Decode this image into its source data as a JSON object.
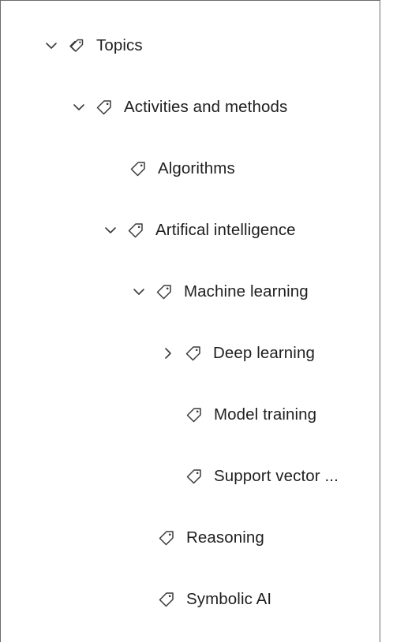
{
  "tree": {
    "items": [
      {
        "label": "Topics",
        "expander": "expanded",
        "icon": "tags-icon"
      },
      {
        "label": "Activities and methods",
        "expander": "expanded",
        "icon": "tag-icon"
      },
      {
        "label": "Algorithms",
        "expander": "none",
        "icon": "tag-icon"
      },
      {
        "label": "Artifical intelligence",
        "expander": "expanded",
        "icon": "tag-icon"
      },
      {
        "label": "Machine learning",
        "expander": "expanded",
        "icon": "tag-icon"
      },
      {
        "label": "Deep learning",
        "expander": "collapsed",
        "icon": "tag-icon"
      },
      {
        "label": "Model training",
        "expander": "none",
        "icon": "tag-icon"
      },
      {
        "label": "Support vector ...",
        "expander": "none",
        "icon": "tag-icon"
      },
      {
        "label": "Reasoning",
        "expander": "none",
        "icon": "tag-icon"
      },
      {
        "label": "Symbolic AI",
        "expander": "none",
        "icon": "tag-icon"
      }
    ]
  },
  "colors": {
    "text": "#1f1f1f",
    "icon": "#3a3a3a",
    "border": "#6b6b6b"
  }
}
